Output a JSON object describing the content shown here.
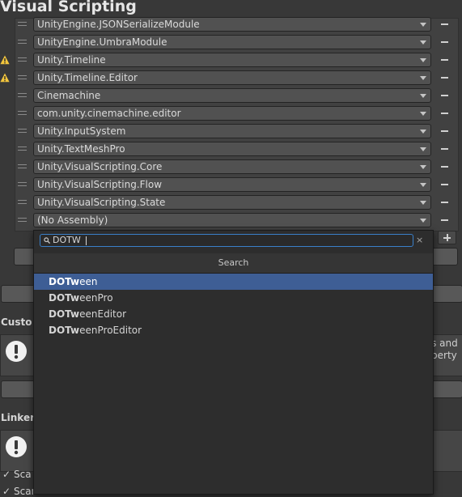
{
  "header": {
    "title": "Visual Scripting"
  },
  "assemblies": [
    {
      "value": "UnityEngine.JSONSerializeModule",
      "warning": false
    },
    {
      "value": "UnityEngine.UmbraModule",
      "warning": false
    },
    {
      "value": "Unity.Timeline",
      "warning": true
    },
    {
      "value": "Unity.Timeline.Editor",
      "warning": true
    },
    {
      "value": "Cinemachine",
      "warning": false
    },
    {
      "value": "com.unity.cinemachine.editor",
      "warning": false
    },
    {
      "value": "Unity.InputSystem",
      "warning": false
    },
    {
      "value": "Unity.TextMeshPro",
      "warning": false
    },
    {
      "value": "Unity.VisualScripting.Core",
      "warning": false
    },
    {
      "value": "Unity.VisualScripting.Flow",
      "warning": false
    },
    {
      "value": "Unity.VisualScripting.State",
      "warning": false
    },
    {
      "value": "(No Assembly)",
      "warning": false
    }
  ],
  "background": {
    "section1_label": "Custo",
    "help1_line1": "tes and",
    "help1_line2": "roperty",
    "section2_label": "Linker",
    "toggle1_label": "Sca",
    "toggle2_label": "Scan scenes"
  },
  "popup": {
    "search_value": "DOTW",
    "clear_glyph": "×",
    "header": "Search",
    "results": [
      {
        "match": "DOTw",
        "rest": "een",
        "selected": true
      },
      {
        "match": "DOTw",
        "rest": "eenPro",
        "selected": false
      },
      {
        "match": "DOTw",
        "rest": "eenEditor",
        "selected": false
      },
      {
        "match": "DOTw",
        "rest": "eenProEditor",
        "selected": false
      }
    ]
  },
  "colors": {
    "background": "#383838",
    "selection": "#3e5e95",
    "focus": "#3a7fc9",
    "warning": "#f2c53d"
  },
  "icons": {
    "warning": "warning-icon",
    "exclamation": "exclamation-icon",
    "search": "search-icon",
    "clear": "clear-icon",
    "drag": "drag-handle-icon",
    "dropdown": "chevron-down-icon",
    "remove": "minus-icon",
    "add": "plus-icon",
    "check": "checkmark-icon"
  }
}
